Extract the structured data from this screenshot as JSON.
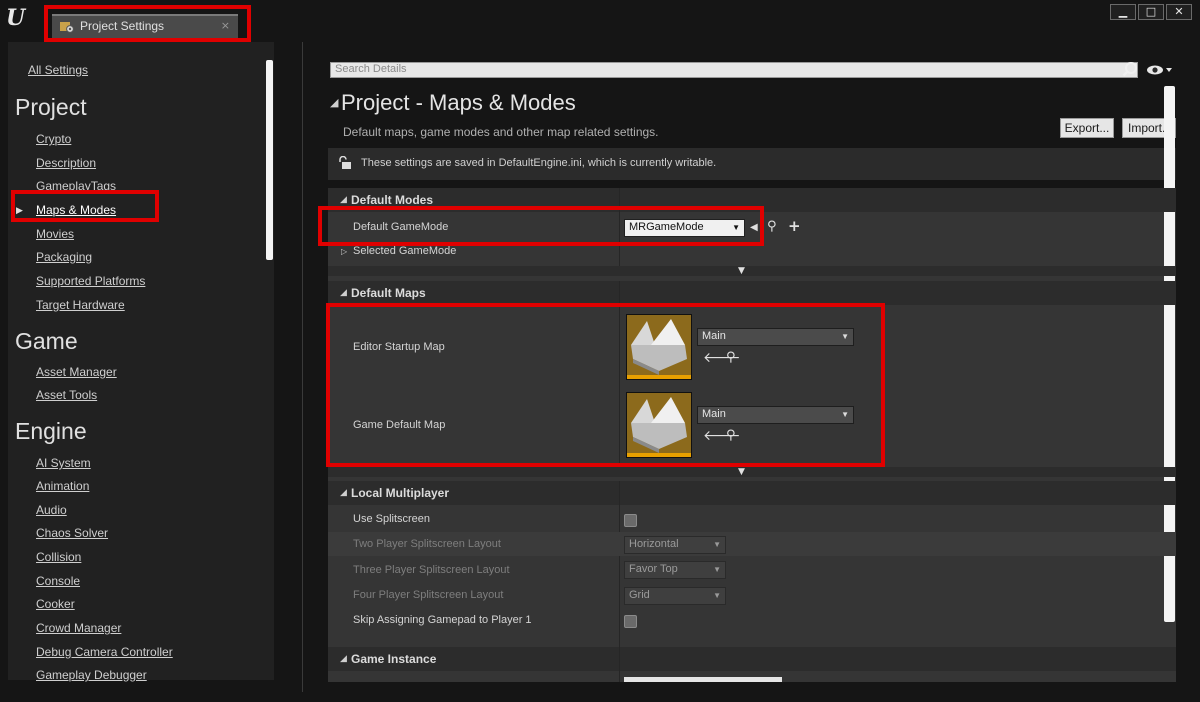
{
  "window": {
    "tab_title": "Project Settings",
    "tab_close": "×",
    "minimize": "▁",
    "maximize": "□",
    "close": "✕"
  },
  "sidebar": {
    "all_settings": "All Settings",
    "sections": [
      {
        "title": "Project",
        "items": [
          "Crypto",
          "Description",
          "GameplayTags",
          "Maps & Modes",
          "Movies",
          "Packaging",
          "Supported Platforms",
          "Target Hardware"
        ]
      },
      {
        "title": "Game",
        "items": [
          "Asset Manager",
          "Asset Tools"
        ]
      },
      {
        "title": "Engine",
        "items": [
          "AI System",
          "Animation",
          "Audio",
          "Chaos Solver",
          "Collision",
          "Console",
          "Cooker",
          "Crowd Manager",
          "Debug Camera Controller",
          "Gameplay Debugger"
        ]
      }
    ],
    "selected_item": "Maps & Modes"
  },
  "details": {
    "search_placeholder": "Search Details",
    "title": "Project - Maps & Modes",
    "subtitle": "Default maps, game modes and other map related settings.",
    "export_label": "Export...",
    "import_label": "Import...",
    "info_text": "These settings are saved in DefaultEngine.ini, which is currently writable."
  },
  "sections": {
    "default_modes": {
      "title": "Default Modes",
      "default_gamemode_label": "Default GameMode",
      "default_gamemode_value": "MRGameMode",
      "selected_gamemode_label": "Selected GameMode"
    },
    "default_maps": {
      "title": "Default Maps",
      "editor_startup_label": "Editor Startup Map",
      "editor_startup_value": "Main",
      "game_default_label": "Game Default Map",
      "game_default_value": "Main"
    },
    "local_multiplayer": {
      "title": "Local Multiplayer",
      "use_splitscreen_label": "Use Splitscreen",
      "use_splitscreen_checked": false,
      "two_player_label": "Two Player Splitscreen Layout",
      "two_player_value": "Horizontal",
      "three_player_label": "Three Player Splitscreen Layout",
      "three_player_value": "Favor Top",
      "four_player_label": "Four Player Splitscreen Layout",
      "four_player_value": "Grid",
      "skip_gamepad_label": "Skip Assigning Gamepad to Player 1",
      "skip_gamepad_checked": false
    },
    "game_instance": {
      "title": "Game Instance"
    }
  },
  "colors": {
    "annotation_red": "#e00000",
    "map_thumbnail_bar": "#e8a000",
    "panel_bg": "#353535"
  }
}
